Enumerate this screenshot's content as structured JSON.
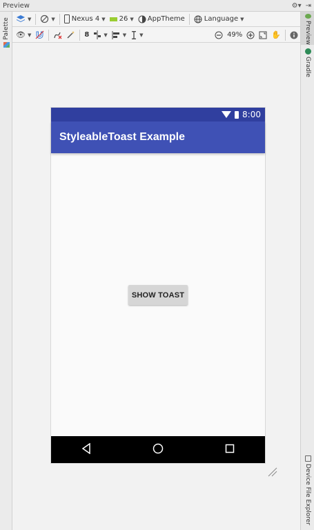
{
  "window": {
    "title": "Preview"
  },
  "left_panel": {
    "palette_label": "Palette"
  },
  "right_panel": {
    "preview_label": "Preview",
    "gradle_label": "Gradle",
    "device_file_explorer_label": "Device File Explorer"
  },
  "toolbar1": {
    "device": "Nexus 4",
    "api_level": "26",
    "theme": "AppTheme",
    "language": "Language"
  },
  "toolbar2": {
    "zoom_level": "49%",
    "magnet_label": "8"
  },
  "device": {
    "status_time": "8:00",
    "app_title": "StyleableToast Example",
    "button_label": "SHOW TOAST"
  },
  "colors": {
    "status_bar": "#303f9f",
    "app_bar": "#3f51b5",
    "nav_bar": "#000000",
    "button": "#d6d6d6"
  }
}
